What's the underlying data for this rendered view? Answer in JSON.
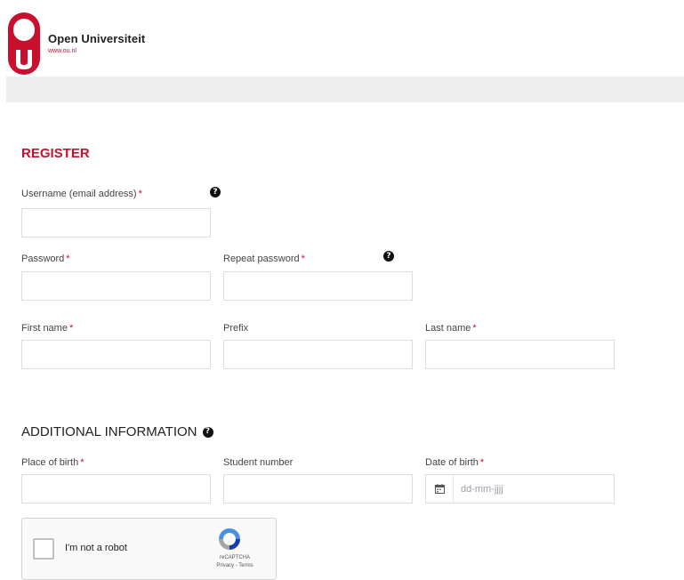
{
  "header": {
    "brand_name": "Open Universiteit",
    "brand_url": "www.ou.nl",
    "logo_icon": "ou-logo-icon",
    "brand_color": "#c8102e"
  },
  "register": {
    "title": "REGISTER",
    "username_label": "Username (email address)",
    "password_label": "Password",
    "repeat_password_label": "Repeat password",
    "first_name_label": "First name",
    "prefix_label": "Prefix",
    "last_name_label": "Last name",
    "required_marker": "*"
  },
  "additional": {
    "title": "ADDITIONAL INFORMATION",
    "place_of_birth_label": "Place of birth",
    "student_number_label": "Student number",
    "date_of_birth_label": "Date of birth",
    "date_placeholder": "dd-mm-jjjj",
    "calendar_icon": "calendar-icon"
  },
  "recaptcha": {
    "label": "I'm not a robot",
    "brand": "reCAPTCHA",
    "links": "Privacy - Terms"
  },
  "help_icon": "question-circle-icon"
}
